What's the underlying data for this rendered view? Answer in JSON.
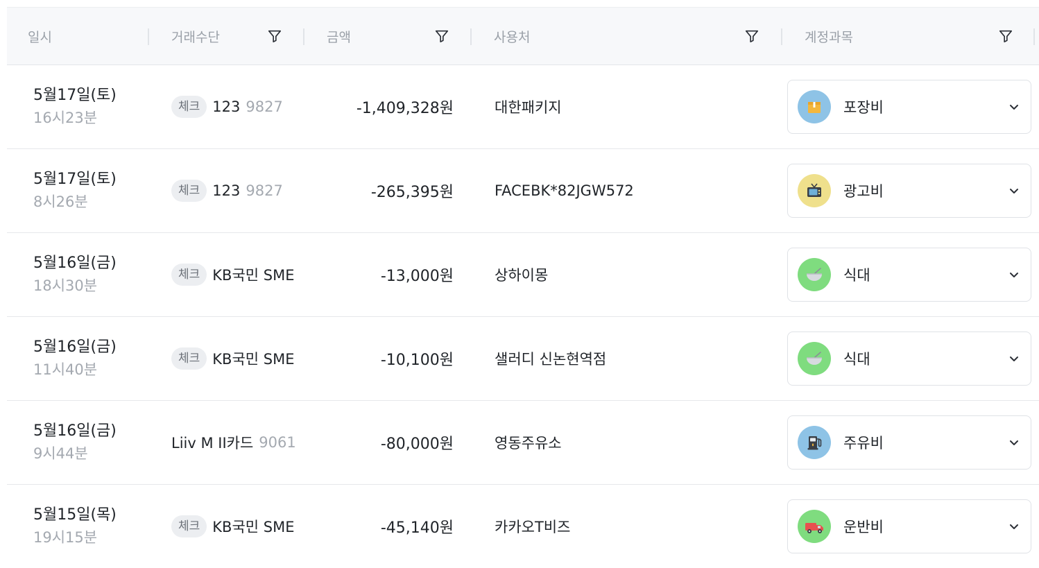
{
  "header": {
    "columns": [
      {
        "label": "일시",
        "filter": false
      },
      {
        "label": "거래수단",
        "filter": true
      },
      {
        "label": "금액",
        "filter": true
      },
      {
        "label": "사용처",
        "filter": true
      },
      {
        "label": "계정과목",
        "filter": true
      }
    ]
  },
  "rows": [
    {
      "date": "5월17일(토)",
      "time": "16시23분",
      "badge": "체크",
      "method_name": "123",
      "method_num": "9827",
      "amount": "-1,409,328원",
      "merchant": "대한패키지",
      "account": "포장비",
      "account_icon": "package-icon"
    },
    {
      "date": "5월17일(토)",
      "time": "8시26분",
      "badge": "체크",
      "method_name": "123",
      "method_num": "9827",
      "amount": "-265,395원",
      "merchant": "FACEBK*82JGW572",
      "account": "광고비",
      "account_icon": "tv-icon"
    },
    {
      "date": "5월16일(금)",
      "time": "18시30분",
      "badge": "체크",
      "method_name": "KB국민 SME",
      "method_num": "",
      "amount": "-13,000원",
      "merchant": "상하이몽",
      "account": "식대",
      "account_icon": "bowl-icon"
    },
    {
      "date": "5월16일(금)",
      "time": "11시40분",
      "badge": "체크",
      "method_name": "KB국민 SME",
      "method_num": "",
      "amount": "-10,100원",
      "merchant": "샐러디 신논현역점",
      "account": "식대",
      "account_icon": "bowl-icon"
    },
    {
      "date": "5월16일(금)",
      "time": "9시44분",
      "badge": "",
      "method_name": "Liiv M II카드",
      "method_num": "9061",
      "amount": "-80,000원",
      "merchant": "영동주유소",
      "account": "주유비",
      "account_icon": "fuel-pump-icon"
    },
    {
      "date": "5월15일(목)",
      "time": "19시15분",
      "badge": "체크",
      "method_name": "KB국민 SME",
      "method_num": "",
      "amount": "-45,140원",
      "merchant": "카카오T비즈",
      "account": "운반비",
      "account_icon": "truck-icon"
    }
  ],
  "colors": {
    "header_bg": "#f7f8fa",
    "header_text": "#9aa0a8",
    "text": "#1f2328",
    "muted": "#a4a9b0",
    "badge_bg": "#eceef1",
    "icon_package_bg": "#8ec3e6",
    "icon_tv_bg": "#efe08c",
    "icon_bowl_bg": "#7fdc7f",
    "icon_fuel_bg": "#8ec3e6",
    "icon_truck_bg": "#7fdc7f"
  }
}
